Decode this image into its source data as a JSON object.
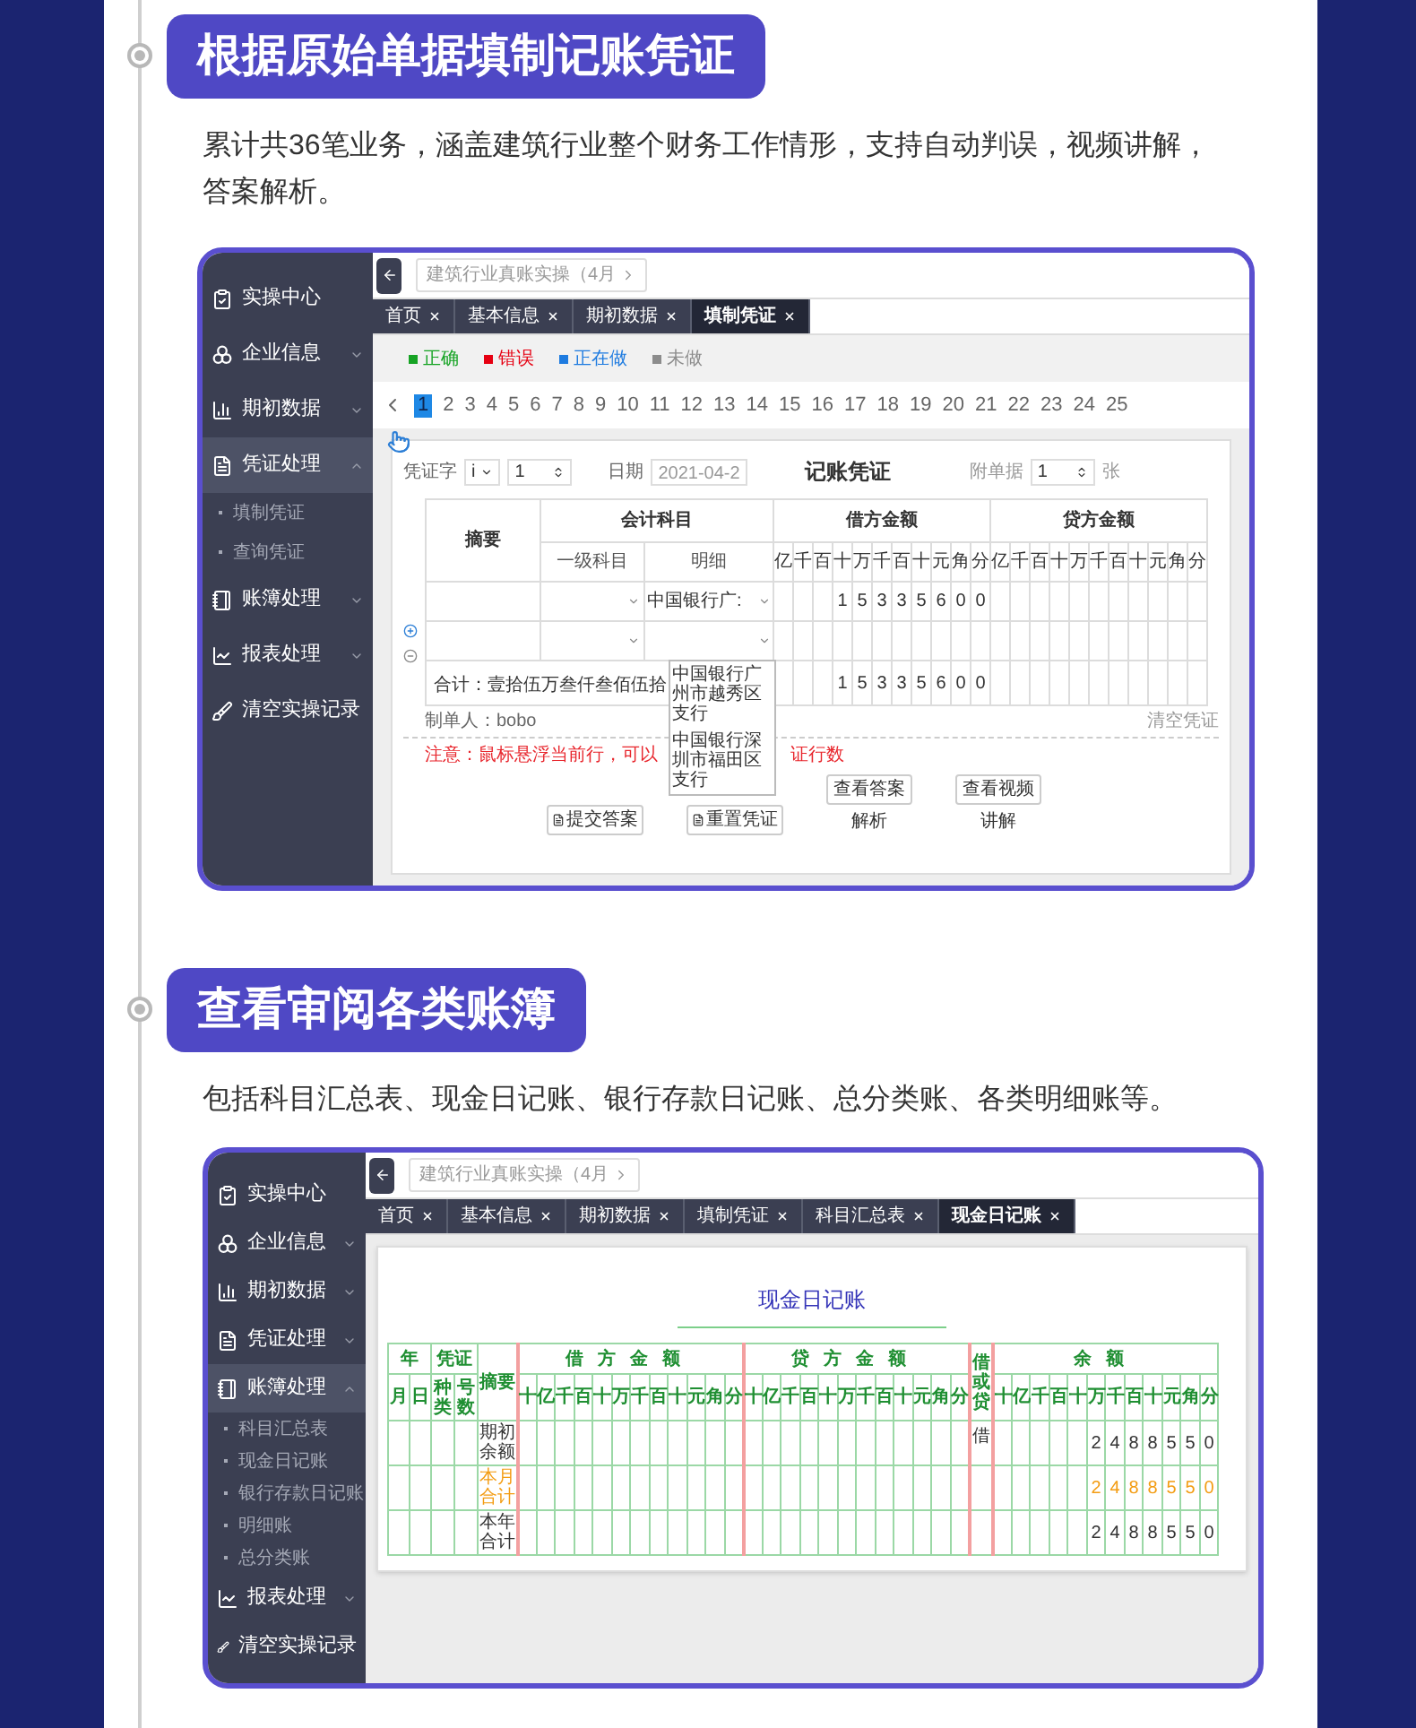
{
  "sections": [
    {
      "kind": "voucher",
      "title": "根据原始单据填制记账凭证",
      "description": "累计共36笔业务，涵盖建筑行业整个财务工作情形，支持自动判误，视频讲解，答案解析。",
      "app": {
        "sidebar": [
          {
            "label": "实操中心",
            "kind": "link",
            "selected": false
          },
          {
            "label": "企业信息",
            "kind": "group",
            "selected": false,
            "expanded": false
          },
          {
            "label": "期初数据",
            "kind": "group",
            "selected": false,
            "expanded": false
          },
          {
            "label": "凭证处理",
            "kind": "group",
            "selected": true,
            "expanded": true,
            "children": [
              {
                "label": "填制凭证"
              },
              {
                "label": "查询凭证"
              }
            ]
          },
          {
            "label": "账簿处理",
            "kind": "group",
            "selected": false,
            "expanded": false
          },
          {
            "label": "报表处理",
            "kind": "group",
            "selected": false,
            "expanded": false
          },
          {
            "label": "清空实操记录",
            "kind": "link",
            "selected": false
          }
        ],
        "project": "建筑行业真账实操（4月",
        "tabs": [
          {
            "label": "首页",
            "selected": false
          },
          {
            "label": "基本信息",
            "selected": false
          },
          {
            "label": "期初数据",
            "selected": false
          },
          {
            "label": "填制凭证",
            "selected": true
          }
        ]
      },
      "voucher": {
        "legend": [
          {
            "label": "正确",
            "color": "#16a324"
          },
          {
            "label": "错误",
            "color": "#e60012"
          },
          {
            "label": "正在做",
            "color": "#1e7be0"
          },
          {
            "label": "未做",
            "color": "#8c8c8c"
          }
        ],
        "pages": [
          {
            "label": "1",
            "selected": true
          },
          {
            "label": "2",
            "selected": false
          },
          {
            "label": "3",
            "selected": false
          },
          {
            "label": "4",
            "selected": false
          },
          {
            "label": "5",
            "selected": false
          },
          {
            "label": "6",
            "selected": false
          },
          {
            "label": "7",
            "selected": false
          },
          {
            "label": "8",
            "selected": false
          },
          {
            "label": "9",
            "selected": false
          },
          {
            "label": "10",
            "selected": false
          },
          {
            "label": "11",
            "selected": false
          },
          {
            "label": "12",
            "selected": false
          },
          {
            "label": "13",
            "selected": false
          },
          {
            "label": "14",
            "selected": false
          },
          {
            "label": "15",
            "selected": false
          },
          {
            "label": "16",
            "selected": false
          },
          {
            "label": "17",
            "selected": false
          },
          {
            "label": "18",
            "selected": false
          },
          {
            "label": "19",
            "selected": false
          },
          {
            "label": "20",
            "selected": false
          },
          {
            "label": "21",
            "selected": false
          },
          {
            "label": "22",
            "selected": false
          },
          {
            "label": "23",
            "selected": false
          },
          {
            "label": "24",
            "selected": false
          },
          {
            "label": "25",
            "selected": false
          }
        ],
        "form": {
          "type_label": "凭证字",
          "type_value": "i",
          "number": "1",
          "date_label": "日期",
          "date": "2021-04-2",
          "title": "记账凭证",
          "attach_label": "附单据",
          "attach_count": "1",
          "attach_unit": "张"
        },
        "headers": {
          "summary": "摘要",
          "account": "会计科目",
          "account_main": "一级科目",
          "account_detail": "明细",
          "debit": "借方金额",
          "credit": "贷方金额"
        },
        "debit_digit_labels": [
          "亿",
          "千",
          "百",
          "十",
          "万",
          "千",
          "百",
          "十",
          "元",
          "角",
          "分"
        ],
        "credit_digit_labels": [
          "亿",
          "千",
          "百",
          "十",
          "万",
          "千",
          "百",
          "十",
          "元",
          "角",
          "分"
        ],
        "rows": [
          {
            "kind": "entry",
            "detail": "中国银行广:",
            "debit": [
              "1",
              "5",
              "3",
              "3",
              "5",
              "6",
              "0",
              "0"
            ]
          },
          {
            "kind": "entry"
          }
        ],
        "total": {
          "label": "合计：壹拾伍万叁仟叁佰伍拾",
          "debit": [
            "1",
            "5",
            "3",
            "3",
            "5",
            "6",
            "0",
            "0"
          ]
        },
        "dropdown": [
          "中国银行广州市越秀区支行",
          "中国银行深圳市福田区支行"
        ],
        "maker": "制单人：bobo",
        "clear": "清空凭证",
        "note_parts": [
          "注意：鼠标悬浮当前行，可以",
          "证行数"
        ],
        "buttons": [
          {
            "kind": "icon",
            "label": "提交答案"
          },
          {
            "kind": "icon",
            "label": "重置凭证"
          },
          {
            "kind": "caption",
            "label": "查看答案",
            "caption": "解析"
          },
          {
            "kind": "caption",
            "label": "查看视频",
            "caption": "讲解"
          }
        ]
      }
    },
    {
      "kind": "ledger",
      "title": "查看审阅各类账簿",
      "description": "包括科目汇总表、现金日记账、银行存款日记账、总分类账、各类明细账等。",
      "app": {
        "sidebar": [
          {
            "label": "实操中心",
            "kind": "link",
            "selected": false
          },
          {
            "label": "企业信息",
            "kind": "group",
            "selected": false,
            "expanded": false
          },
          {
            "label": "期初数据",
            "kind": "group",
            "selected": false,
            "expanded": false
          },
          {
            "label": "凭证处理",
            "kind": "group",
            "selected": false,
            "expanded": false
          },
          {
            "label": "账簿处理",
            "kind": "group",
            "selected": true,
            "expanded": true,
            "children": [
              {
                "label": "科目汇总表"
              },
              {
                "label": "现金日记账"
              },
              {
                "label": "银行存款日记账"
              },
              {
                "label": "明细账"
              },
              {
                "label": "总分类账"
              }
            ]
          },
          {
            "label": "报表处理",
            "kind": "group",
            "selected": false,
            "expanded": false
          },
          {
            "label": "清空实操记录",
            "kind": "link",
            "selected": false
          }
        ],
        "project": "建筑行业真账实操（4月",
        "tabs": [
          {
            "label": "首页",
            "selected": false
          },
          {
            "label": "基本信息",
            "selected": false
          },
          {
            "label": "期初数据",
            "selected": false
          },
          {
            "label": "填制凭证",
            "selected": false
          },
          {
            "label": "科目汇总表",
            "selected": false
          },
          {
            "label": "现金日记账",
            "selected": true
          }
        ]
      },
      "ledger": {
        "title": "现金日记账",
        "headers": {
          "year": "年",
          "month": "月",
          "day": "日",
          "voucher": "凭证",
          "voucher_type": "种类",
          "voucher_no": "号数",
          "summary": "摘要",
          "debit": "借方金额",
          "credit": "贷方金额",
          "direction": "借或贷",
          "balance": "余额"
        },
        "debit_digit_labels": [
          "十",
          "亿",
          "千",
          "百",
          "十",
          "万",
          "千",
          "百",
          "十",
          "元",
          "角",
          "分"
        ],
        "credit_digit_labels": [
          "十",
          "亿",
          "千",
          "百",
          "十",
          "万",
          "千",
          "百",
          "十",
          "元",
          "角",
          "分"
        ],
        "balance_digit_labels": [
          "十",
          "亿",
          "千",
          "百",
          "十",
          "万",
          "千",
          "百",
          "十",
          "元",
          "角",
          "分"
        ],
        "rows": [
          {
            "summary": "期初余额",
            "direction": "借",
            "balance": [
              "2",
              "4",
              "8",
              "8",
              "5",
              "5",
              "0"
            ],
            "highlighted": false
          },
          {
            "summary": "本月合计",
            "balance": [
              "2",
              "4",
              "8",
              "8",
              "5",
              "5",
              "0"
            ],
            "highlighted": true
          },
          {
            "summary": "本年合计",
            "balance": [
              "2",
              "4",
              "8",
              "8",
              "5",
              "5",
              "0"
            ],
            "highlighted": false
          }
        ]
      }
    }
  ]
}
